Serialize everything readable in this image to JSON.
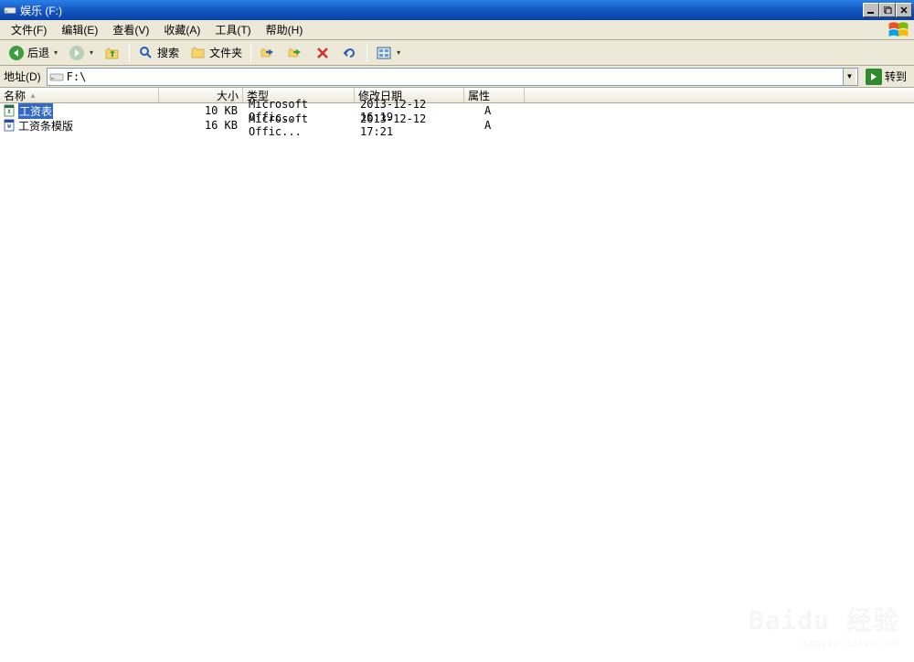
{
  "window": {
    "title": "娱乐 (F:)"
  },
  "menubar": {
    "file": "文件(F)",
    "edit": "编辑(E)",
    "view": "查看(V)",
    "favorites": "收藏(A)",
    "tools": "工具(T)",
    "help": "帮助(H)"
  },
  "toolbar": {
    "back": "后退",
    "search": "搜索",
    "folders": "文件夹"
  },
  "addressbar": {
    "label": "地址(D)",
    "value": "F:\\",
    "go": "转到"
  },
  "columns": {
    "name": "名称",
    "size": "大小",
    "type": "类型",
    "modified": "修改日期",
    "attr": "属性"
  },
  "files": [
    {
      "name": "工资表",
      "size": "10 KB",
      "type": "Microsoft Offic...",
      "modified": "2013-12-12 16:19",
      "attr": "A",
      "selected": true
    },
    {
      "name": "工资条模版",
      "size": "16 KB",
      "type": "Microsoft Offic...",
      "modified": "2013-12-12 17:21",
      "attr": "A",
      "selected": false
    }
  ],
  "watermark": {
    "brand": "Baidu 经验",
    "url": "jingyan.baidu.com"
  }
}
